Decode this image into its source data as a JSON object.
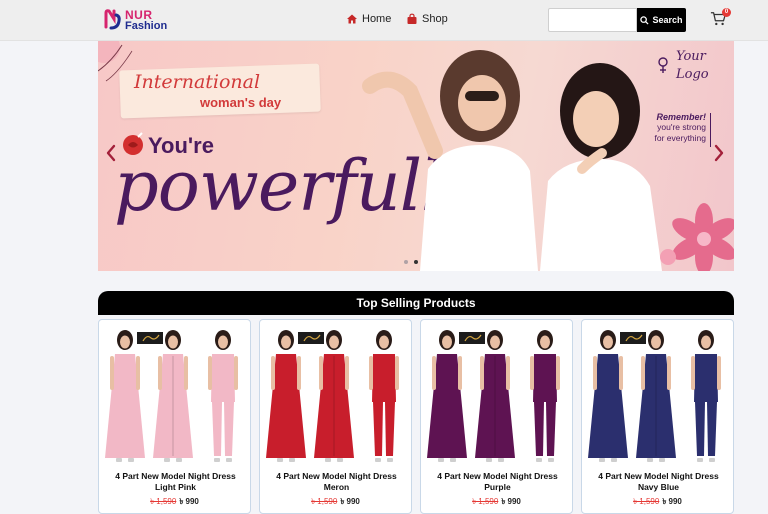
{
  "brand": {
    "line1": "NUR",
    "line2": "Fashion",
    "colors": {
      "pink": "#d6246e",
      "navy": "#1f2c8f"
    }
  },
  "nav": [
    {
      "label": "Home",
      "icon": "home-icon"
    },
    {
      "label": "Shop",
      "icon": "shopping-bag-icon"
    }
  ],
  "search": {
    "value": "",
    "placeholder": "",
    "button_label": "Search"
  },
  "cart": {
    "count": "0"
  },
  "banner": {
    "ribbon_title": "International",
    "ribbon_subtitle": "woman's day",
    "headline": "You're",
    "headline_script": "powerfull",
    "logo_text_1": "Your",
    "logo_text_2": "Logo",
    "remember_title": "Remember!",
    "remember_line1": "you're strong",
    "remember_line2": "for everything",
    "active_slide": 2,
    "slide_count": 2
  },
  "section": {
    "title": "Top Selling Products"
  },
  "products": [
    {
      "name": "4 Part New Model Night Dress Light Pink",
      "old_price": "৳ 1,590",
      "price": "৳ 990",
      "color": "#f2b8c6"
    },
    {
      "name": "4 Part New Model Night Dress Meron",
      "old_price": "৳ 1,590",
      "price": "৳ 990",
      "color": "#c81e2c"
    },
    {
      "name": "4 Part New Model Night Dress Purple",
      "old_price": "৳ 1,590",
      "price": "৳ 990",
      "color": "#5e1352"
    },
    {
      "name": "4 Part New Model Night Dress Navy Blue",
      "old_price": "৳ 1,590",
      "price": "৳ 990",
      "color": "#2b2f6e"
    }
  ]
}
